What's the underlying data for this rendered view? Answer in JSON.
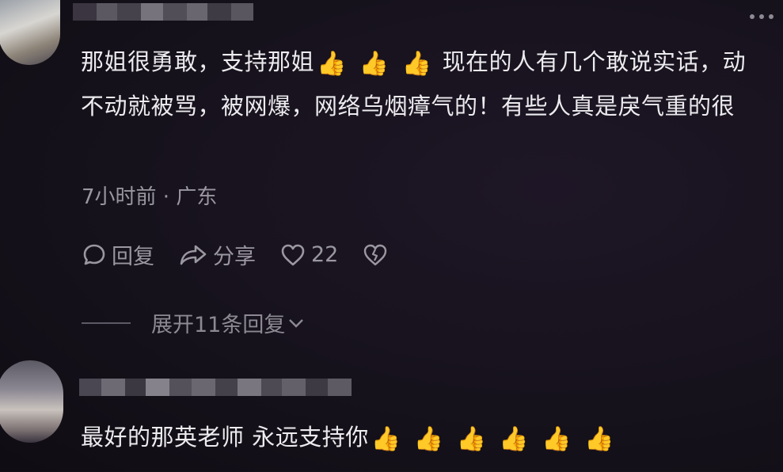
{
  "comments": [
    {
      "text_parts": [
        {
          "t": "text",
          "v": "那姐很勇敢，支持那姐"
        },
        {
          "t": "emoji",
          "v": "👍"
        },
        {
          "t": "emoji",
          "v": "👍"
        },
        {
          "t": "emoji",
          "v": "👍"
        },
        {
          "t": "text",
          "v": "现在的人有几个敢说实话，动不动就被骂，被网爆，网络乌烟瘴气的！有些人真是戾气重的很"
        }
      ],
      "meta": "7小时前 · 广东",
      "actions": {
        "reply_label": "回复",
        "share_label": "分享",
        "like_count": "22"
      },
      "expand_label": "展开11条回复"
    },
    {
      "text_parts": [
        {
          "t": "text",
          "v": "最好的那英老师  永远支持你"
        },
        {
          "t": "emoji",
          "v": "👍"
        },
        {
          "t": "emoji",
          "v": "👍"
        },
        {
          "t": "emoji",
          "v": "👍"
        },
        {
          "t": "emoji",
          "v": "👍"
        },
        {
          "t": "emoji",
          "v": "👍"
        },
        {
          "t": "emoji",
          "v": "👍"
        }
      ]
    }
  ],
  "colors": {
    "background": "#16121c",
    "text": "#ecebee",
    "muted": "#9b97a1",
    "thumb": "#f6c223"
  },
  "icons": {
    "reply": "comment-bubble-icon",
    "share": "share-arrow-icon",
    "like": "heart-icon",
    "dislike": "broken-heart-icon",
    "expand": "chevron-down-icon",
    "more": "more-dots-icon"
  }
}
